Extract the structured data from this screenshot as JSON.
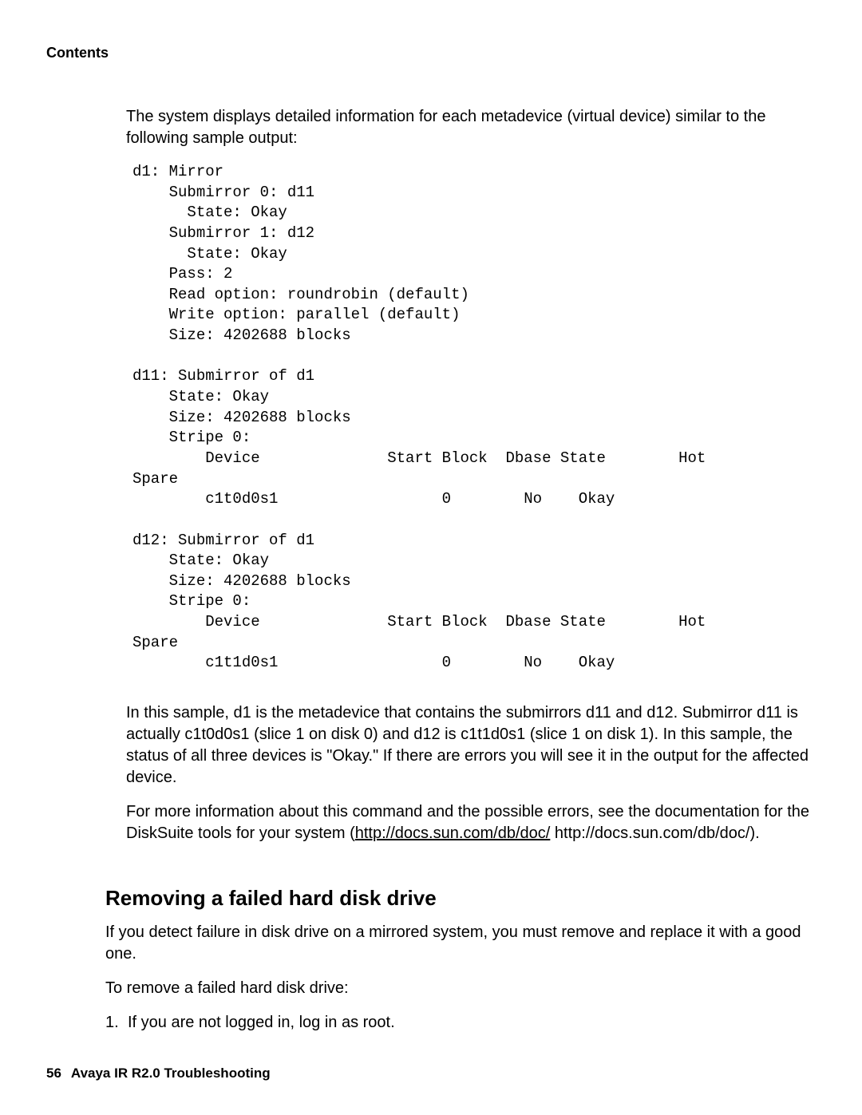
{
  "header": {
    "contents": "Contents"
  },
  "intro": {
    "p1": "The system displays detailed information for each metadevice (virtual device) similar to the following sample output:"
  },
  "code": {
    "text": "d1: Mirror\n    Submirror 0: d11\n      State: Okay\n    Submirror 1: d12\n      State: Okay\n    Pass: 2\n    Read option: roundrobin (default)\n    Write option: parallel (default)\n    Size: 4202688 blocks\n\nd11: Submirror of d1\n    State: Okay\n    Size: 4202688 blocks\n    Stripe 0:\n        Device              Start Block  Dbase State        Hot\nSpare\n        c1t0d0s1                  0        No    Okay\n\nd12: Submirror of d1\n    State: Okay\n    Size: 4202688 blocks\n    Stripe 0:\n        Device              Start Block  Dbase State        Hot\nSpare\n        c1t1d0s1                  0        No    Okay"
  },
  "after": {
    "p1": "In this sample, d1 is the metadevice that contains the submirrors d11 and d12. Submirror d11 is actually c1t0d0s1 (slice 1 on disk 0) and d12 is c1t1d0s1 (slice 1 on disk 1). In this sample, the status of all three devices is \"Okay.\" If there are errors you will see it in the output for the affected device.",
    "p2_pre": "For more information about this command and the possible errors, see the documentation for the DiskSuite tools for your system (",
    "p2_link": "http://docs.sun.com/db/doc/",
    "p2_post": " http://docs.sun.com/db/doc/)."
  },
  "section": {
    "heading": "Removing a failed hard disk drive",
    "p1": "If you detect failure in disk drive on a mirrored system, you must remove and replace it with a good one.",
    "p2": "To remove a failed hard disk drive:",
    "step1_marker": "1.",
    "step1_text": "If you are not logged in, log in as root."
  },
  "footer": {
    "page_number": "56",
    "title": "Avaya IR R2.0 Troubleshooting"
  }
}
